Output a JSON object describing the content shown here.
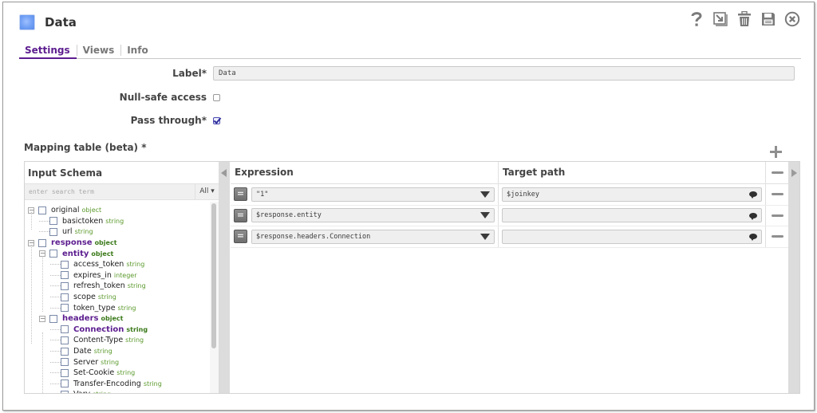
{
  "window": {
    "title": "Data",
    "toolbar": [
      {
        "name": "help-icon",
        "label": "Help"
      },
      {
        "name": "export-icon",
        "label": "Export"
      },
      {
        "name": "trash-icon",
        "label": "Delete"
      },
      {
        "name": "save-icon",
        "label": "Save"
      },
      {
        "name": "close-icon",
        "label": "Close"
      }
    ]
  },
  "tabs": [
    {
      "label": "Settings",
      "active": true
    },
    {
      "label": "Views",
      "active": false
    },
    {
      "label": "Info",
      "active": false
    }
  ],
  "form": {
    "label_field": {
      "label": "Label*",
      "value": "Data"
    },
    "null_safe": {
      "label": "Null-safe access",
      "checked": false
    },
    "pass_through": {
      "label": "Pass through*",
      "checked": true
    }
  },
  "mapping": {
    "title": "Mapping table (beta) *",
    "schema": {
      "header": "Input Schema",
      "search_placeholder": "enter search term",
      "filter": "All ▾",
      "tree": [
        {
          "name": "original",
          "type": "object",
          "level": 0,
          "expandable": true,
          "bold": false
        },
        {
          "name": "basictoken",
          "type": "string",
          "level": 1,
          "expandable": false,
          "bold": false
        },
        {
          "name": "url",
          "type": "string",
          "level": 1,
          "expandable": false,
          "bold": false
        },
        {
          "name": "response",
          "type": "object",
          "level": 0,
          "expandable": true,
          "bold": true
        },
        {
          "name": "entity",
          "type": "object",
          "level": 1,
          "expandable": true,
          "bold": true
        },
        {
          "name": "access_token",
          "type": "string",
          "level": 2,
          "expandable": false,
          "bold": false
        },
        {
          "name": "expires_in",
          "type": "integer",
          "level": 2,
          "expandable": false,
          "bold": false
        },
        {
          "name": "refresh_token",
          "type": "string",
          "level": 2,
          "expandable": false,
          "bold": false
        },
        {
          "name": "scope",
          "type": "string",
          "level": 2,
          "expandable": false,
          "bold": false
        },
        {
          "name": "token_type",
          "type": "string",
          "level": 2,
          "expandable": false,
          "bold": false
        },
        {
          "name": "headers",
          "type": "object",
          "level": 1,
          "expandable": true,
          "bold": true
        },
        {
          "name": "Connection",
          "type": "string",
          "level": 2,
          "expandable": false,
          "bold": true
        },
        {
          "name": "Content-Type",
          "type": "string",
          "level": 2,
          "expandable": false,
          "bold": false
        },
        {
          "name": "Date",
          "type": "string",
          "level": 2,
          "expandable": false,
          "bold": false
        },
        {
          "name": "Server",
          "type": "string",
          "level": 2,
          "expandable": false,
          "bold": false
        },
        {
          "name": "Set-Cookie",
          "type": "string",
          "level": 2,
          "expandable": false,
          "bold": false
        },
        {
          "name": "Transfer-Encoding",
          "type": "string",
          "level": 2,
          "expandable": false,
          "bold": false
        },
        {
          "name": "Vary",
          "type": "string",
          "level": 2,
          "expandable": false,
          "bold": false
        }
      ]
    },
    "columns": {
      "expression": "Expression",
      "target": "Target path"
    },
    "rows": [
      {
        "expression": "\"1\"",
        "target": "$joinkey"
      },
      {
        "expression": "$response.entity",
        "target": ""
      },
      {
        "expression": "$response.headers.Connection",
        "target": ""
      }
    ]
  }
}
